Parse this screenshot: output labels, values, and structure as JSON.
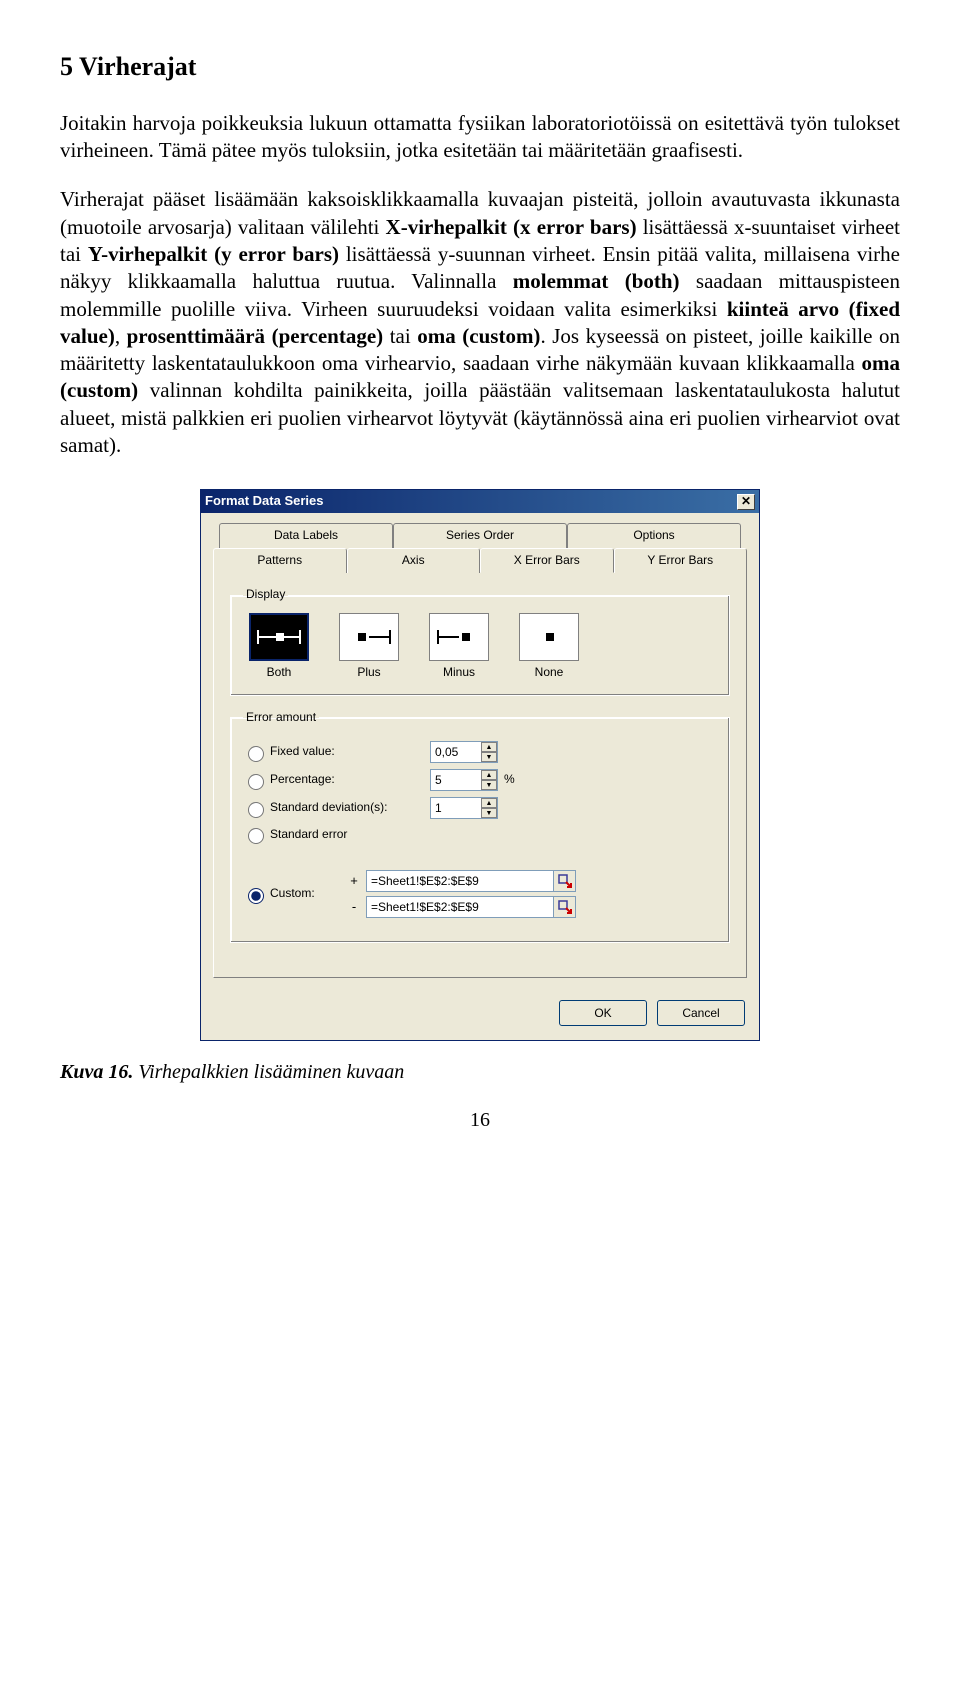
{
  "doc": {
    "heading": "5  Virherajat",
    "para1": "Joitakin harvoja poikkeuksia lukuun ottamatta fysiikan laboratoriotöissä on esitettävä työn tulokset virheineen. Tämä pätee myös tuloksiin, jotka esitetään tai määritetään graafisesti.",
    "para2_parts": [
      "Virherajat pääset lisäämään kaksoisklikkaamalla kuvaajan pisteitä, jolloin avautuvasta ikkunasta (muotoile arvosarja) valitaan välilehti ",
      "X-virhepalkit (x error bars)",
      " lisättäessä x-suuntaiset virheet tai ",
      "Y-virhepalkit (y error bars)",
      " lisättäessä y-suunnan virheet. Ensin pitää valita, millaisena virhe näkyy klikkaamalla haluttua ruutua. Valinnalla ",
      "molemmat (both)",
      " saadaan mittauspisteen molemmille puolille viiva. Virheen suuruudeksi voidaan valita esimerkiksi ",
      "kiinteä arvo (fixed value)",
      ", ",
      "prosenttimäärä (percentage)",
      " tai ",
      "oma (custom)",
      ". Jos kyseessä on pisteet, joille kaikille on määritetty laskentataulukkoon oma virhearvio, saadaan virhe näkymään kuvaan klikkaamalla ",
      "oma (custom)",
      " valinnan kohdilta painikkeita, joilla päästään valitsemaan laskentataulukosta halutut alueet, mistä palkkien eri puolien virhearvot löytyvät (käytännössä aina eri puolien virhearviot ovat samat)."
    ],
    "caption_label": "Kuva 16.",
    "caption_text": " Virhepalkkien lisääminen kuvaan",
    "page_number": "16"
  },
  "dialog": {
    "title": "Format Data Series",
    "tabs_back": [
      "Data Labels",
      "Series Order",
      "Options"
    ],
    "tabs_front": [
      "Patterns",
      "Axis",
      "X Error Bars",
      "Y Error Bars"
    ],
    "active_tab": "X Error Bars",
    "group_display": "Display",
    "display_options": [
      "Both",
      "Plus",
      "Minus",
      "None"
    ],
    "display_selected": "Both",
    "group_error": "Error amount",
    "rows": {
      "fixed_label": "Fixed value:",
      "fixed_value": "0,05",
      "pct_label": "Percentage:",
      "pct_value": "5",
      "pct_unit": "%",
      "stddev_label": "Standard deviation(s):",
      "stddev_value": "1",
      "stderr_label": "Standard error",
      "custom_label": "Custom:",
      "custom_selected": true,
      "custom_plus_sign": "+",
      "custom_minus_sign": "-",
      "custom_plus_ref": "=Sheet1!$E$2:$E$9",
      "custom_minus_ref": "=Sheet1!$E$2:$E$9"
    },
    "buttons": {
      "ok": "OK",
      "cancel": "Cancel"
    }
  }
}
